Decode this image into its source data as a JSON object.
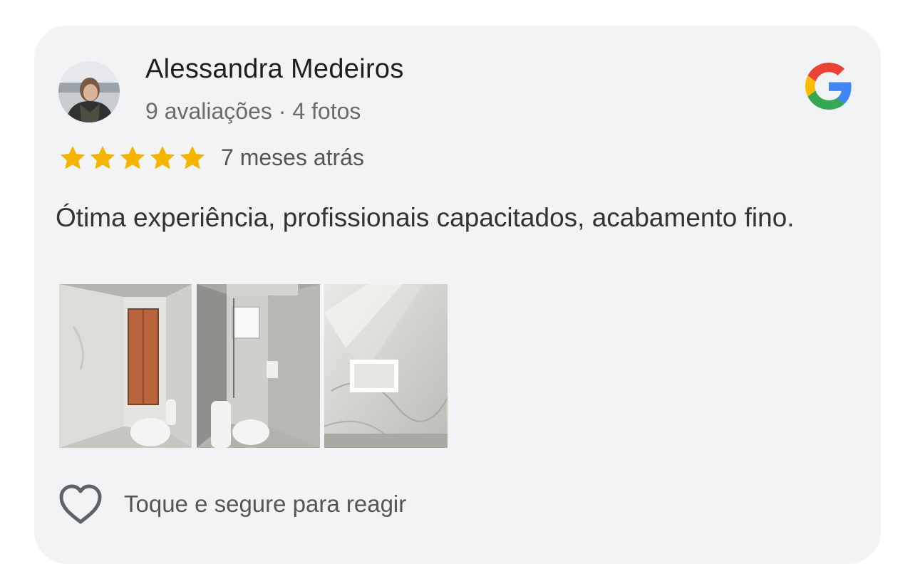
{
  "review": {
    "author_name": "Alessandra Medeiros",
    "author_meta": "9 avaliações · 4 fotos",
    "rating": 5,
    "rating_max": 5,
    "star_color": "#f5b400",
    "time_ago": "7 meses atrás",
    "text": "Ótima experiência, profissionais capacitados, acabamento fino.",
    "source_icon": "google-g-logo",
    "photos": [
      {
        "name": "bathroom-door-photo"
      },
      {
        "name": "bathroom-shower-photo"
      },
      {
        "name": "bathroom-niche-photo"
      }
    ]
  },
  "reaction": {
    "icon": "heart-outline-icon",
    "label": "Toque e segure para reagir"
  },
  "colors": {
    "card_background": "#f2f3f5",
    "name_text": "#1f1f1f",
    "secondary_text": "#6b6b6b"
  }
}
